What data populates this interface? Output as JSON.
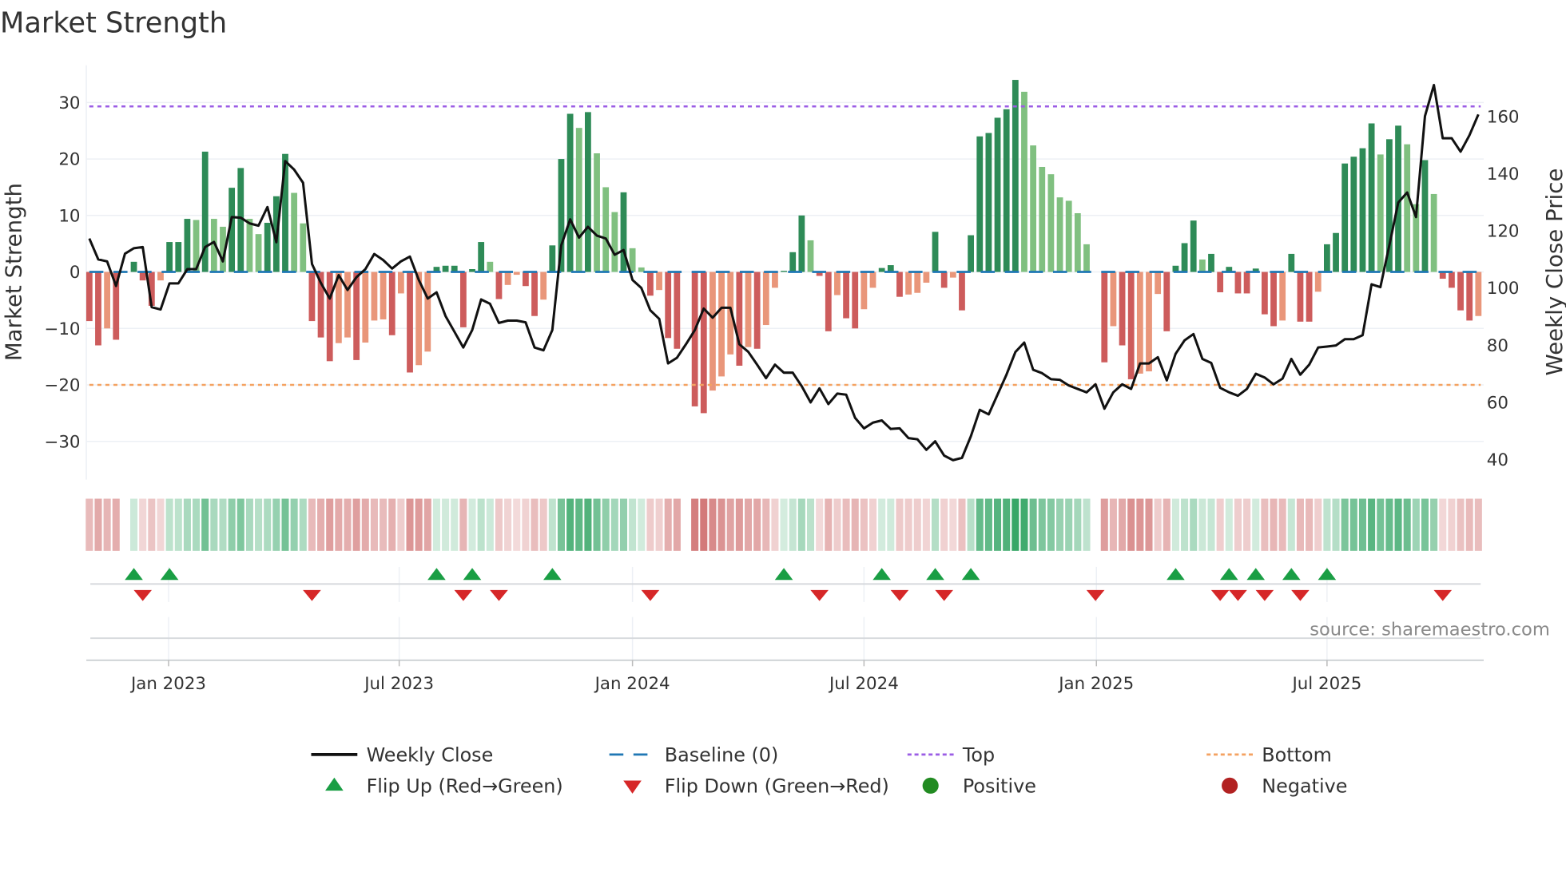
{
  "title": "Market Strength",
  "source": "source: sharemaestro.com",
  "chart_data": {
    "type": "bar",
    "title": "Market Strength",
    "interval": "weekly",
    "ylabel": "Market Strength",
    "y2label": "Weekly Close Price",
    "ylim": [
      -37,
      37
    ],
    "y2lim": [
      34,
      178
    ],
    "yticks": [
      {
        "v": 30,
        "label": "30"
      },
      {
        "v": 20,
        "label": "20"
      },
      {
        "v": 10,
        "label": "10"
      },
      {
        "v": 0,
        "label": "0"
      },
      {
        "v": -10,
        "label": "−10"
      },
      {
        "v": -20,
        "label": "−20"
      },
      {
        "v": -30,
        "label": "−30"
      }
    ],
    "y2ticks": [
      {
        "v": 160,
        "label": "160"
      },
      {
        "v": 140,
        "label": "140"
      },
      {
        "v": 120,
        "label": "120"
      },
      {
        "v": 100,
        "label": "100"
      },
      {
        "v": 80,
        "label": "80"
      },
      {
        "v": 60,
        "label": "60"
      },
      {
        "v": 40,
        "label": "40"
      }
    ],
    "xticks": [
      {
        "week": 8.9,
        "label": "Jan 2023"
      },
      {
        "week": 34.8,
        "label": "Jul 2023"
      },
      {
        "week": 61.0,
        "label": "Jan 2024"
      },
      {
        "week": 87.0,
        "label": "Jul 2024"
      },
      {
        "week": 113.1,
        "label": "Jan 2025"
      },
      {
        "week": 139.0,
        "label": "Jul 2025"
      }
    ],
    "top_level": 29.3,
    "bottom_level": -20,
    "baseline": 0,
    "strength": [
      -8.7,
      -13,
      -10,
      -12,
      0,
      1.8,
      -1.5,
      -6,
      -1.5,
      5.3,
      5.3,
      9.4,
      9.2,
      21.3,
      9.4,
      8,
      14.9,
      18.4,
      9.4,
      6.7,
      8.7,
      13.4,
      20.9,
      14,
      8.6,
      -8.7,
      -11.6,
      -15.8,
      -12.6,
      -11.6,
      -15.6,
      -12.5,
      -8.6,
      -8.4,
      -11.2,
      -3.8,
      -17.8,
      -16.5,
      -14.1,
      0.9,
      1.1,
      1.1,
      -9.8,
      0.5,
      5.3,
      1.8,
      -4.8,
      -2.3,
      -0.5,
      -2.5,
      -7.8,
      -4.9,
      4.7,
      20,
      28,
      25.5,
      28.3,
      21,
      15,
      10.6,
      14.1,
      4.2,
      0.8,
      -4.2,
      -3.2,
      -11.7,
      -13.6,
      0,
      -23.8,
      -25,
      -21,
      -18.5,
      -14.6,
      -16.6,
      -13.3,
      -13.6,
      -9.4,
      -2.8,
      0.2,
      3.5,
      10,
      5.6,
      -0.7,
      -10.5,
      -4.1,
      -8.2,
      -10,
      -6.6,
      -2.8,
      0.7,
      1.2,
      -4.4,
      -4,
      -3.7,
      -1.9,
      7.1,
      -2.8,
      -1,
      -6.8,
      6.5,
      24,
      24.6,
      27.3,
      28.8,
      34,
      31.9,
      22.4,
      18.6,
      17.3,
      13.2,
      12.6,
      10.4,
      4.9,
      0,
      -16,
      -9.6,
      -13,
      -19,
      -18,
      -17.6,
      -3.9,
      -10.5,
      1.1,
      5.1,
      9.1,
      2.2,
      3.2,
      -3.6,
      0.9,
      -3.8,
      -3.8,
      0.6,
      -7.5,
      -9.6,
      -8.6,
      3.2,
      -8.8,
      -8.8,
      -3.5,
      4.9,
      6.9,
      19.2,
      20.4,
      21.9,
      26.3,
      20.8,
      23.5,
      25.9,
      22.6,
      12,
      19.8,
      13.8,
      -1.2,
      -2.8,
      -6.8,
      -8.6,
      -7.8
    ],
    "weekly_close": [
      117.3,
      110,
      109.3,
      100.7,
      112,
      113.9,
      114.3,
      93.3,
      92.5,
      101.6,
      101.6,
      106.6,
      106.6,
      114.3,
      116.1,
      109.3,
      124.8,
      124.6,
      122.6,
      121.8,
      128.3,
      116,
      144.4,
      141.4,
      136.8,
      108.4,
      101.8,
      96.3,
      104.5,
      99.3,
      103.8,
      106.6,
      111.9,
      109.8,
      106.8,
      109.3,
      111,
      102.8,
      96.3,
      98.5,
      90.2,
      84.7,
      79.2,
      85.3,
      96,
      94.5,
      87.8,
      88.6,
      88.6,
      88,
      79.2,
      78.2,
      85.3,
      114.9,
      124,
      117.6,
      121.4,
      118.3,
      117.3,
      111.6,
      113.3,
      102.8,
      100,
      92.2,
      89.2,
      73.6,
      75.6,
      80.3,
      85.3,
      92.8,
      89.6,
      93.1,
      93.1,
      80.3,
      77.7,
      73.2,
      68.5,
      73.2,
      70.4,
      70.4,
      65.7,
      60,
      64.9,
      59.4,
      63.1,
      62.7,
      54.6,
      50.9,
      52.9,
      53.7,
      50.7,
      50.9,
      47.5,
      47.1,
      43.4,
      46.4,
      41.4,
      39.8,
      40.6,
      48.1,
      57.4,
      55.8,
      62.7,
      69.7,
      77.6,
      80.9,
      71.4,
      70.2,
      68.1,
      67.9,
      65.9,
      64.7,
      63.5,
      66.3,
      57.8,
      63.5,
      66.3,
      64.7,
      73.6,
      73.6,
      75.8,
      67.7,
      77,
      81.7,
      83.9,
      75.2,
      73.8,
      65.1,
      63.5,
      62.3,
      64.7,
      70,
      68.7,
      66.3,
      68.3,
      75.2,
      69.7,
      73.2,
      79.2,
      79.5,
      79.9,
      82.1,
      82.1,
      83.5,
      101.3,
      100.3,
      114.9,
      129.9,
      133.4,
      124.8,
      160.1,
      171,
      152.4,
      152.4,
      147.7,
      153.4,
      160.7
    ],
    "flip_up_weeks": [
      5,
      9,
      39,
      43,
      52,
      78,
      89,
      95,
      99,
      122,
      128,
      131,
      135,
      139
    ],
    "flip_down_weeks": [
      6,
      25,
      42,
      46,
      63,
      82,
      91,
      96,
      113,
      127,
      129,
      132,
      136,
      152
    ],
    "legend": [
      {
        "label": "Weekly Close",
        "kind": "line"
      },
      {
        "label": "Baseline (0)",
        "kind": "dash"
      },
      {
        "label": "Top",
        "kind": "dot-top"
      },
      {
        "label": "Bottom",
        "kind": "dot-bottom"
      },
      {
        "label": "Flip Up (Red→Green)",
        "kind": "tri-up"
      },
      {
        "label": "Flip Down (Green→Red)",
        "kind": "tri-down"
      },
      {
        "label": "Positive",
        "kind": "circle-pos"
      },
      {
        "label": "Negative",
        "kind": "circle-neg"
      }
    ],
    "legend_position": "bottom",
    "colors": {
      "pos_dark": "#2e8b57",
      "pos_light": "#80c080",
      "neg_dark": "#cd5c5c",
      "neg_light": "#e9967a",
      "close": "#111111",
      "baseline": "#1f77b4",
      "top": "#9b5de5",
      "bottom": "#f4a261",
      "flip_up": "#1a9e44",
      "flip_down": "#d62728",
      "positive": "#228b22",
      "negative": "#b22222",
      "strip_pos": "#2ca25f",
      "strip_neg": "#c44e4e"
    }
  }
}
